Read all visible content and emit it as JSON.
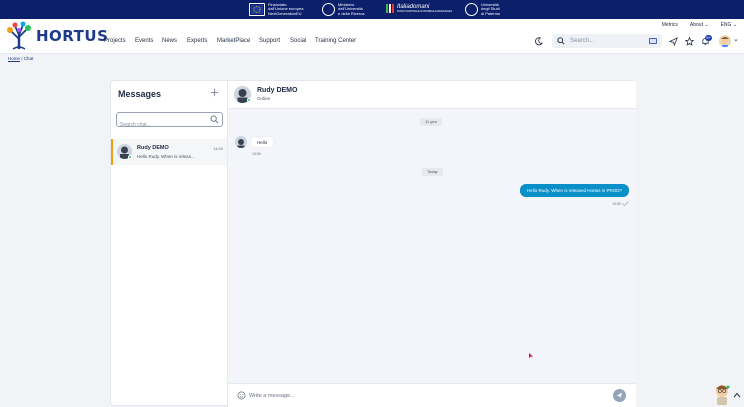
{
  "topbar": {
    "logos": [
      {
        "icon": "eu-flag-icon",
        "lines": [
          "Finanziato",
          "dall'Unione europea",
          "NextGenerationEU"
        ]
      },
      {
        "icon": "ministry-seal-icon",
        "lines": [
          "Ministero",
          "dell'Università",
          "e della Ricerca"
        ]
      },
      {
        "icon": "italia-domani-icon",
        "lines": [
          "Italiadomani",
          "PIANO NAZIONALE DI RIPRESA E RESILIENZA"
        ]
      },
      {
        "icon": "university-seal-icon",
        "lines": [
          "Università",
          "degli Studi",
          "di Palermo"
        ]
      }
    ]
  },
  "navbar": {
    "brand": "HORTUS",
    "items": [
      "Projects",
      "Events",
      "News",
      "Experts",
      "MarketPlace",
      "Support",
      "Social",
      "Training Center"
    ],
    "top_links": [
      "Metrics",
      "About",
      "ENG"
    ],
    "search_placeholder": "Search...",
    "notification_count": "9+"
  },
  "breadcrumb": {
    "home": "Home",
    "separator": "/",
    "current": "Chat"
  },
  "messages_panel": {
    "title": "Messages",
    "search_placeholder": "Search chat...",
    "conversations": [
      {
        "name": "Rudy DEMO",
        "time": "14:50",
        "preview": "Hello Rudy. When is releas..."
      }
    ]
  },
  "chat": {
    "contact_name": "Rudy DEMO",
    "status": "Online",
    "date_separators": [
      "11 gen",
      "Today"
    ],
    "messages": [
      {
        "direction": "incoming",
        "text": "Hello",
        "time": "13:59"
      },
      {
        "direction": "outgoing",
        "text": "Hello Rudy. When is released Hortus in PROD?",
        "time": "14:50"
      }
    ],
    "composer_placeholder": "Write a message..."
  },
  "colors": {
    "topbar": "#0b1f6b",
    "brand": "#1e3a8a",
    "outgoing_bubble": "#0a8fc9",
    "active_accent": "#f59e0b",
    "online": "#22c55e"
  }
}
